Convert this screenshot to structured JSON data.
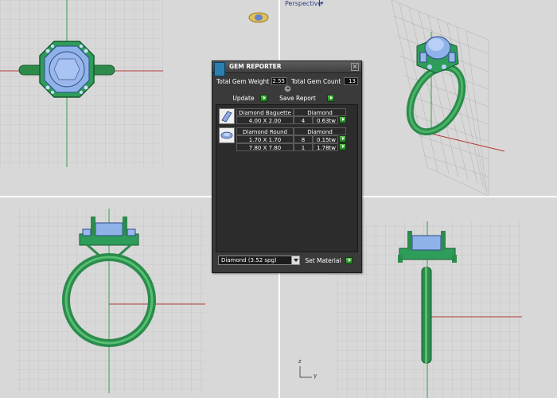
{
  "viewports": {
    "perspective_title": "Perspective",
    "axis_z": "z",
    "axis_y": "y"
  },
  "gem_reporter": {
    "title": "GEM REPORTER",
    "total_weight_label": "Total Gem Weight",
    "total_weight_value": "2.55",
    "total_count_label": "Total Gem Count",
    "total_count_value": "13",
    "update_label": "Update",
    "save_report_label": "Save Report",
    "groups": [
      {
        "icon": "diamond-baguette-icon",
        "shape": "Diamond Baguette",
        "material": "Diamond",
        "rows": [
          {
            "size": "4.00 X 2.00",
            "count": "4",
            "weight": "0.63tw"
          }
        ]
      },
      {
        "icon": "diamond-round-icon",
        "shape": "Diamond Round",
        "material": "Diamond",
        "rows": [
          {
            "size": "1.70 X 1.70",
            "count": "8",
            "weight": "0.15tw"
          },
          {
            "size": "7.80 X 7.80",
            "count": "1",
            "weight": "1.78tw"
          }
        ]
      }
    ],
    "material_selected": "Diamond     (3.52 spg)",
    "set_material_label": "Set Material"
  },
  "colors": {
    "ring_green": "#3a9a55",
    "gem_blue": "#8aa9e6",
    "axis_red": "#b53a3a",
    "axis_green": "#3aa04a",
    "grid_line": "#b9b9b9"
  }
}
